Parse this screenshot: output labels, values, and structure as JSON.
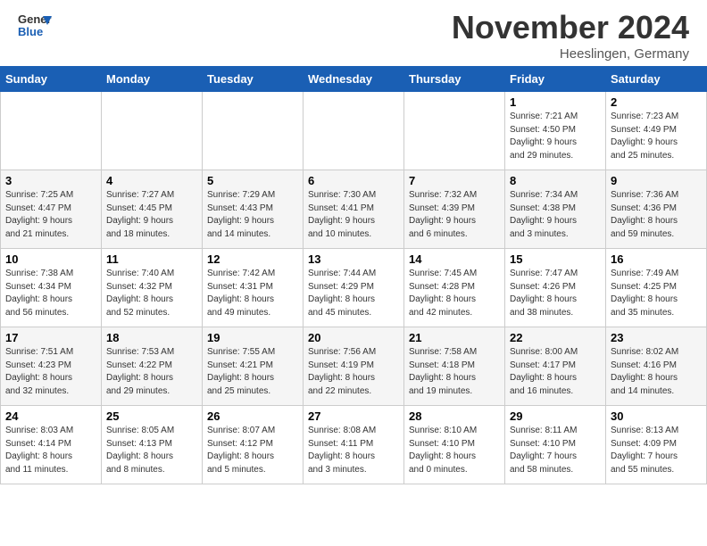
{
  "header": {
    "logo": {
      "line1": "General",
      "line2": "Blue"
    },
    "title": "November 2024",
    "location": "Heeslingen, Germany"
  },
  "weekdays": [
    "Sunday",
    "Monday",
    "Tuesday",
    "Wednesday",
    "Thursday",
    "Friday",
    "Saturday"
  ],
  "weeks": [
    [
      {
        "day": "",
        "info": ""
      },
      {
        "day": "",
        "info": ""
      },
      {
        "day": "",
        "info": ""
      },
      {
        "day": "",
        "info": ""
      },
      {
        "day": "",
        "info": ""
      },
      {
        "day": "1",
        "info": "Sunrise: 7:21 AM\nSunset: 4:50 PM\nDaylight: 9 hours\nand 29 minutes."
      },
      {
        "day": "2",
        "info": "Sunrise: 7:23 AM\nSunset: 4:49 PM\nDaylight: 9 hours\nand 25 minutes."
      }
    ],
    [
      {
        "day": "3",
        "info": "Sunrise: 7:25 AM\nSunset: 4:47 PM\nDaylight: 9 hours\nand 21 minutes."
      },
      {
        "day": "4",
        "info": "Sunrise: 7:27 AM\nSunset: 4:45 PM\nDaylight: 9 hours\nand 18 minutes."
      },
      {
        "day": "5",
        "info": "Sunrise: 7:29 AM\nSunset: 4:43 PM\nDaylight: 9 hours\nand 14 minutes."
      },
      {
        "day": "6",
        "info": "Sunrise: 7:30 AM\nSunset: 4:41 PM\nDaylight: 9 hours\nand 10 minutes."
      },
      {
        "day": "7",
        "info": "Sunrise: 7:32 AM\nSunset: 4:39 PM\nDaylight: 9 hours\nand 6 minutes."
      },
      {
        "day": "8",
        "info": "Sunrise: 7:34 AM\nSunset: 4:38 PM\nDaylight: 9 hours\nand 3 minutes."
      },
      {
        "day": "9",
        "info": "Sunrise: 7:36 AM\nSunset: 4:36 PM\nDaylight: 8 hours\nand 59 minutes."
      }
    ],
    [
      {
        "day": "10",
        "info": "Sunrise: 7:38 AM\nSunset: 4:34 PM\nDaylight: 8 hours\nand 56 minutes."
      },
      {
        "day": "11",
        "info": "Sunrise: 7:40 AM\nSunset: 4:32 PM\nDaylight: 8 hours\nand 52 minutes."
      },
      {
        "day": "12",
        "info": "Sunrise: 7:42 AM\nSunset: 4:31 PM\nDaylight: 8 hours\nand 49 minutes."
      },
      {
        "day": "13",
        "info": "Sunrise: 7:44 AM\nSunset: 4:29 PM\nDaylight: 8 hours\nand 45 minutes."
      },
      {
        "day": "14",
        "info": "Sunrise: 7:45 AM\nSunset: 4:28 PM\nDaylight: 8 hours\nand 42 minutes."
      },
      {
        "day": "15",
        "info": "Sunrise: 7:47 AM\nSunset: 4:26 PM\nDaylight: 8 hours\nand 38 minutes."
      },
      {
        "day": "16",
        "info": "Sunrise: 7:49 AM\nSunset: 4:25 PM\nDaylight: 8 hours\nand 35 minutes."
      }
    ],
    [
      {
        "day": "17",
        "info": "Sunrise: 7:51 AM\nSunset: 4:23 PM\nDaylight: 8 hours\nand 32 minutes."
      },
      {
        "day": "18",
        "info": "Sunrise: 7:53 AM\nSunset: 4:22 PM\nDaylight: 8 hours\nand 29 minutes."
      },
      {
        "day": "19",
        "info": "Sunrise: 7:55 AM\nSunset: 4:21 PM\nDaylight: 8 hours\nand 25 minutes."
      },
      {
        "day": "20",
        "info": "Sunrise: 7:56 AM\nSunset: 4:19 PM\nDaylight: 8 hours\nand 22 minutes."
      },
      {
        "day": "21",
        "info": "Sunrise: 7:58 AM\nSunset: 4:18 PM\nDaylight: 8 hours\nand 19 minutes."
      },
      {
        "day": "22",
        "info": "Sunrise: 8:00 AM\nSunset: 4:17 PM\nDaylight: 8 hours\nand 16 minutes."
      },
      {
        "day": "23",
        "info": "Sunrise: 8:02 AM\nSunset: 4:16 PM\nDaylight: 8 hours\nand 14 minutes."
      }
    ],
    [
      {
        "day": "24",
        "info": "Sunrise: 8:03 AM\nSunset: 4:14 PM\nDaylight: 8 hours\nand 11 minutes."
      },
      {
        "day": "25",
        "info": "Sunrise: 8:05 AM\nSunset: 4:13 PM\nDaylight: 8 hours\nand 8 minutes."
      },
      {
        "day": "26",
        "info": "Sunrise: 8:07 AM\nSunset: 4:12 PM\nDaylight: 8 hours\nand 5 minutes."
      },
      {
        "day": "27",
        "info": "Sunrise: 8:08 AM\nSunset: 4:11 PM\nDaylight: 8 hours\nand 3 minutes."
      },
      {
        "day": "28",
        "info": "Sunrise: 8:10 AM\nSunset: 4:10 PM\nDaylight: 8 hours\nand 0 minutes."
      },
      {
        "day": "29",
        "info": "Sunrise: 8:11 AM\nSunset: 4:10 PM\nDaylight: 7 hours\nand 58 minutes."
      },
      {
        "day": "30",
        "info": "Sunrise: 8:13 AM\nSunset: 4:09 PM\nDaylight: 7 hours\nand 55 minutes."
      }
    ]
  ]
}
